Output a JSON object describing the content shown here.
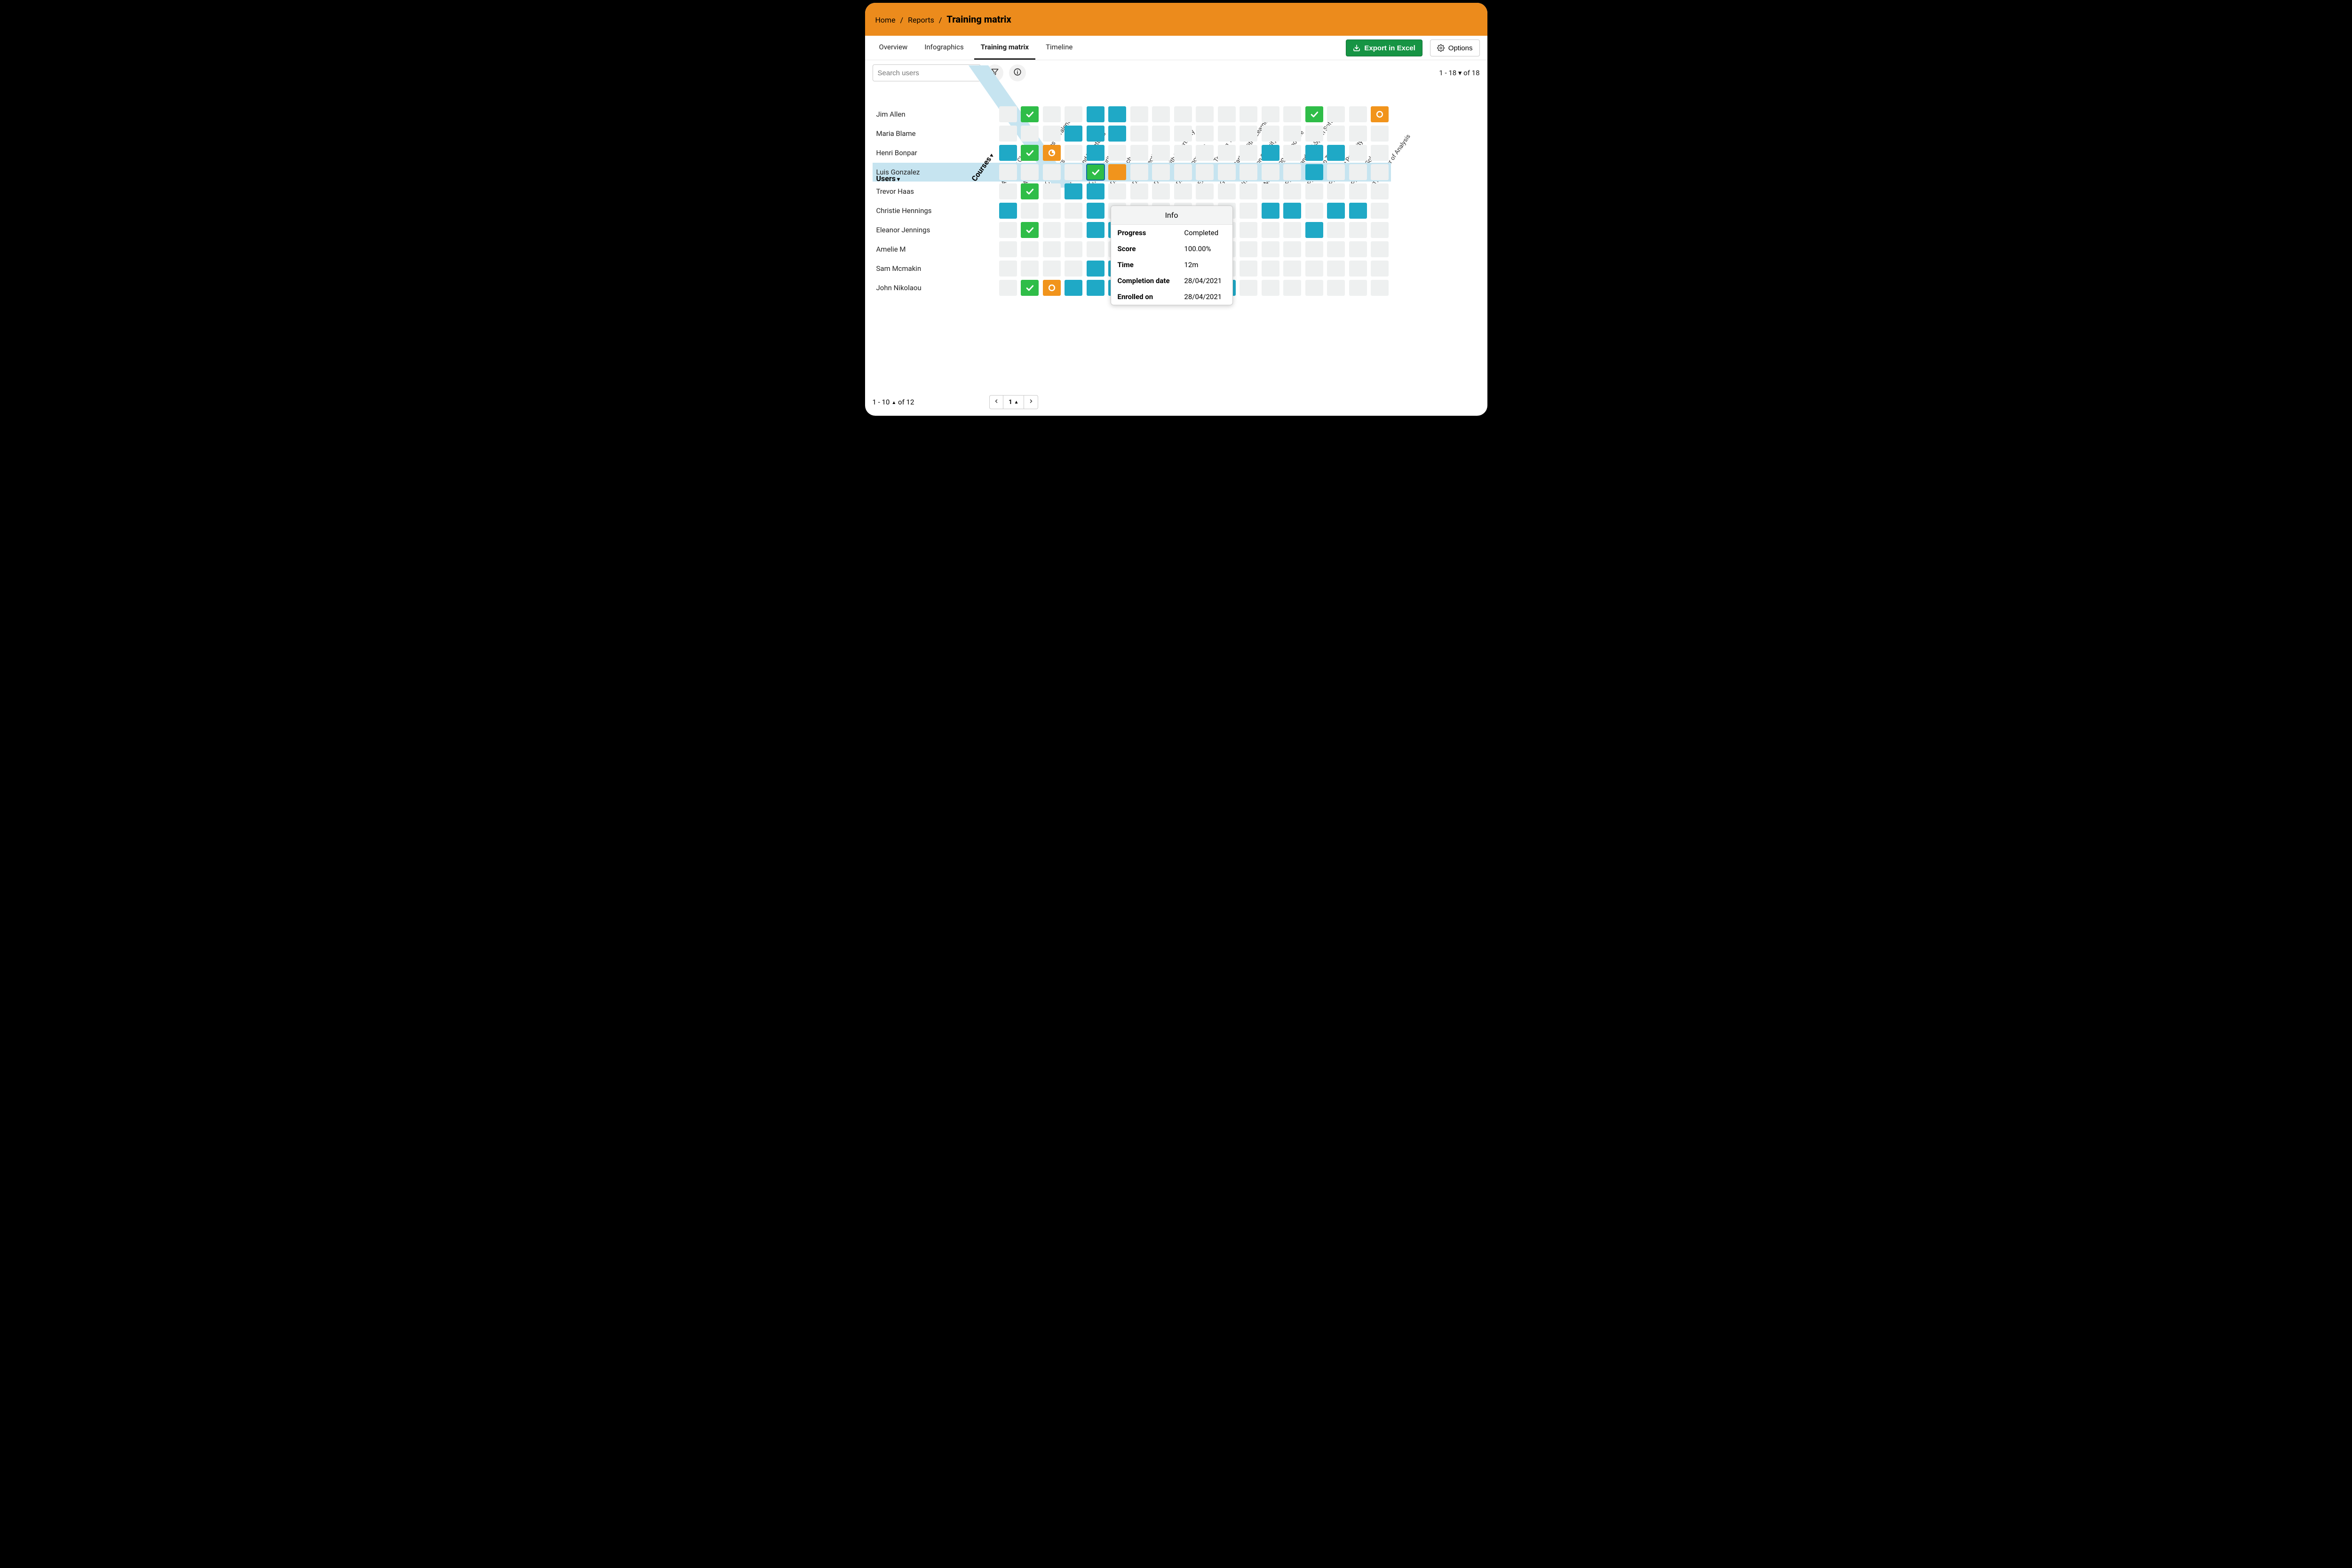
{
  "breadcrumb": {
    "home": "Home",
    "reports": "Reports",
    "current": "Training matrix"
  },
  "tabs": {
    "overview": "Overview",
    "infographics": "Infographics",
    "matrix": "Training matrix",
    "timeline": "Timeline"
  },
  "buttons": {
    "export": "Export in Excel",
    "options": "Options"
  },
  "toolbar": {
    "search_placeholder": "Search users",
    "top_range": "1 - 18 ▾ of 18"
  },
  "headers": {
    "users": "Users",
    "courses": "Courses"
  },
  "footer": {
    "range": "1 - 10",
    "range_suffix": "of 12",
    "page": "1"
  },
  "courses": [
    "Achieving Clarity",
    "Advanced Features of TalentLMS",
    "Computers",
    "Content and TalentLMS",
    "Cybersecurity I",
    "Data Breaches",
    "Data Protection",
    "Dealing with Uncertainty",
    "Driving Innovation",
    "Employee Training 101",
    "Getting Started With eLearning",
    "Information Security",
    "Maintaining Composure",
    "Phishing and Anti-Spam Softwar...",
    "Photoshop Tricks",
    "Practicing Positivity",
    "Problem-Solving",
    "The Power of Analysis"
  ],
  "highlight_col_index": 4,
  "highlight_row_index": 3,
  "rows": [
    {
      "user": "Jim Allen",
      "cells": {
        "1": "green-check",
        "4": "teal",
        "5": "teal",
        "14": "green-check",
        "17": "orange-ring"
      }
    },
    {
      "user": "Maria Blame",
      "cells": {
        "3": "teal",
        "4": "teal",
        "5": "teal"
      }
    },
    {
      "user": "Henri Bonpar",
      "cells": {
        "0": "teal",
        "1": "green-check",
        "2": "orange-pie",
        "4": "teal",
        "12": "teal",
        "14": "teal",
        "15": "teal"
      }
    },
    {
      "user": "Luis Gonzalez",
      "cells": {
        "4": "green-check sel",
        "5": "orange-half",
        "14": "teal"
      }
    },
    {
      "user": "Trevor Haas",
      "cells": {
        "1": "green-check",
        "3": "teal",
        "4": "teal"
      }
    },
    {
      "user": "Christie Hennings",
      "cells": {
        "0": "teal",
        "4": "teal",
        "12": "teal",
        "13": "teal",
        "15": "teal",
        "16": "teal"
      }
    },
    {
      "user": "Eleanor Jennings",
      "cells": {
        "1": "green-check",
        "4": "teal",
        "5": "teal",
        "14": "teal"
      }
    },
    {
      "user": "Amelie M",
      "cells": {}
    },
    {
      "user": "Sam Mcmakin",
      "cells": {
        "4": "teal",
        "5": "teal"
      }
    },
    {
      "user": "John Nikolaou",
      "cells": {
        "1": "green-check",
        "2": "orange-ring",
        "3": "teal",
        "4": "teal",
        "5": "teal",
        "9": "teal",
        "10": "teal"
      }
    }
  ],
  "tooltip": {
    "title": "Info",
    "rows": [
      {
        "label": "Progress",
        "value": "Completed"
      },
      {
        "label": "Score",
        "value": "100.00%"
      },
      {
        "label": "Time",
        "value": "12m"
      },
      {
        "label": "Completion date",
        "value": "28/04/2021"
      },
      {
        "label": "Enrolled on",
        "value": "28/04/2021"
      }
    ]
  }
}
